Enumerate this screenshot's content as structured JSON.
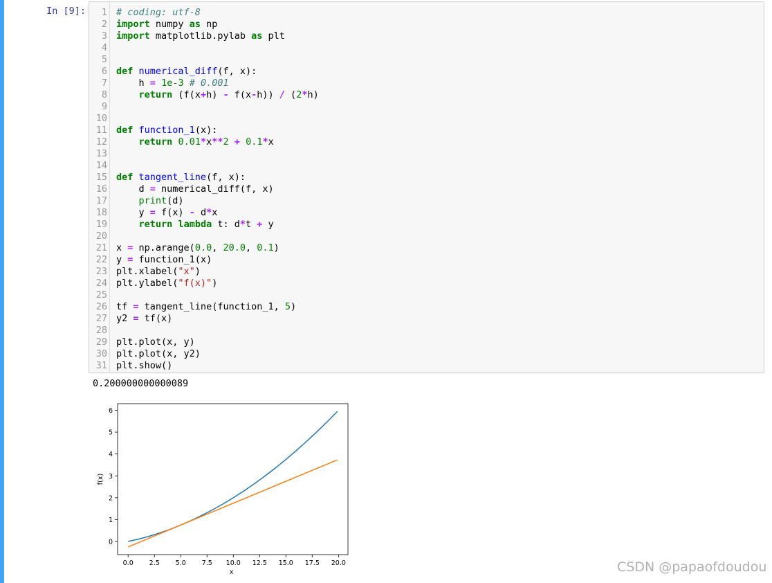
{
  "cell": {
    "prompt": "In [9]:",
    "lines": [
      [
        {
          "t": "# coding: utf-8",
          "c": "cm"
        }
      ],
      [
        {
          "t": "import",
          "c": "kw"
        },
        {
          "t": " numpy "
        },
        {
          "t": "as",
          "c": "kw"
        },
        {
          "t": " np"
        }
      ],
      [
        {
          "t": "import",
          "c": "kw"
        },
        {
          "t": " matplotlib.pylab "
        },
        {
          "t": "as",
          "c": "kw"
        },
        {
          "t": " plt"
        }
      ],
      [],
      [],
      [
        {
          "t": "def",
          "c": "kw"
        },
        {
          "t": " "
        },
        {
          "t": "numerical_diff",
          "c": "nf"
        },
        {
          "t": "(f, x):"
        }
      ],
      [
        {
          "t": "    h "
        },
        {
          "t": "=",
          "c": "op"
        },
        {
          "t": " "
        },
        {
          "t": "1e-3",
          "c": "num"
        },
        {
          "t": " "
        },
        {
          "t": "# 0.001",
          "c": "cm"
        }
      ],
      [
        {
          "t": "    "
        },
        {
          "t": "return",
          "c": "kw"
        },
        {
          "t": " (f(x"
        },
        {
          "t": "+",
          "c": "op"
        },
        {
          "t": "h) "
        },
        {
          "t": "-",
          "c": "op"
        },
        {
          "t": " f(x"
        },
        {
          "t": "-",
          "c": "op"
        },
        {
          "t": "h)) "
        },
        {
          "t": "/",
          "c": "op"
        },
        {
          "t": " ("
        },
        {
          "t": "2",
          "c": "num"
        },
        {
          "t": "*",
          "c": "op"
        },
        {
          "t": "h)"
        }
      ],
      [],
      [],
      [
        {
          "t": "def",
          "c": "kw"
        },
        {
          "t": " "
        },
        {
          "t": "function_1",
          "c": "nf"
        },
        {
          "t": "(x):"
        }
      ],
      [
        {
          "t": "    "
        },
        {
          "t": "return",
          "c": "kw"
        },
        {
          "t": " "
        },
        {
          "t": "0.01",
          "c": "num"
        },
        {
          "t": "*",
          "c": "op"
        },
        {
          "t": "x"
        },
        {
          "t": "**",
          "c": "op"
        },
        {
          "t": "2",
          "c": "num"
        },
        {
          "t": " "
        },
        {
          "t": "+",
          "c": "op"
        },
        {
          "t": " "
        },
        {
          "t": "0.1",
          "c": "num"
        },
        {
          "t": "*",
          "c": "op"
        },
        {
          "t": "x"
        }
      ],
      [],
      [],
      [
        {
          "t": "def",
          "c": "kw"
        },
        {
          "t": " "
        },
        {
          "t": "tangent_line",
          "c": "nf"
        },
        {
          "t": "(f, x):"
        }
      ],
      [
        {
          "t": "    d "
        },
        {
          "t": "=",
          "c": "op"
        },
        {
          "t": " numerical_diff(f, x)"
        }
      ],
      [
        {
          "t": "    "
        },
        {
          "t": "print",
          "c": "bi"
        },
        {
          "t": "(d)"
        }
      ],
      [
        {
          "t": "    y "
        },
        {
          "t": "=",
          "c": "op"
        },
        {
          "t": " f(x) "
        },
        {
          "t": "-",
          "c": "op"
        },
        {
          "t": " d"
        },
        {
          "t": "*",
          "c": "op"
        },
        {
          "t": "x"
        }
      ],
      [
        {
          "t": "    "
        },
        {
          "t": "return",
          "c": "kw"
        },
        {
          "t": " "
        },
        {
          "t": "lambda",
          "c": "kw"
        },
        {
          "t": " t: d"
        },
        {
          "t": "*",
          "c": "op"
        },
        {
          "t": "t "
        },
        {
          "t": "+",
          "c": "op"
        },
        {
          "t": " y"
        }
      ],
      [],
      [
        {
          "t": "x "
        },
        {
          "t": "=",
          "c": "op"
        },
        {
          "t": " np.arange("
        },
        {
          "t": "0.0",
          "c": "num"
        },
        {
          "t": ", "
        },
        {
          "t": "20.0",
          "c": "num"
        },
        {
          "t": ", "
        },
        {
          "t": "0.1",
          "c": "num"
        },
        {
          "t": ")"
        }
      ],
      [
        {
          "t": "y "
        },
        {
          "t": "=",
          "c": "op"
        },
        {
          "t": " function_1(x)"
        }
      ],
      [
        {
          "t": "plt.xlabel("
        },
        {
          "t": "\"x\"",
          "c": "str"
        },
        {
          "t": ")"
        }
      ],
      [
        {
          "t": "plt.ylabel("
        },
        {
          "t": "\"f(x)\"",
          "c": "str"
        },
        {
          "t": ")"
        }
      ],
      [],
      [
        {
          "t": "tf "
        },
        {
          "t": "=",
          "c": "op"
        },
        {
          "t": " tangent_line(function_1, "
        },
        {
          "t": "5",
          "c": "num"
        },
        {
          "t": ")"
        }
      ],
      [
        {
          "t": "y2 "
        },
        {
          "t": "=",
          "c": "op"
        },
        {
          "t": " tf(x)"
        }
      ],
      [],
      [
        {
          "t": "plt.plot(x, y)"
        }
      ],
      [
        {
          "t": "plt.plot(x, y2)"
        }
      ],
      [
        {
          "t": "plt.show()"
        }
      ]
    ]
  },
  "output": {
    "text": "0.200000000000089"
  },
  "chart_data": {
    "type": "line",
    "xlabel": "x",
    "ylabel": "f(x)",
    "xlim": [
      -1.0,
      20.9
    ],
    "ylim": [
      -0.6,
      6.3
    ],
    "xticks": [
      "0.0",
      "2.5",
      "5.0",
      "7.5",
      "10.0",
      "12.5",
      "15.0",
      "17.5",
      "20.0"
    ],
    "yticks": [
      "0",
      "1",
      "2",
      "3",
      "4",
      "5",
      "6"
    ],
    "grid": false,
    "series": [
      {
        "color": "#1f77b4",
        "x": [
          0,
          1,
          2,
          3,
          4,
          5,
          6,
          7,
          8,
          9,
          10,
          11,
          12,
          13,
          14,
          15,
          16,
          17,
          18,
          19,
          19.9
        ],
        "y": [
          0,
          0.11,
          0.24,
          0.39,
          0.56,
          0.75,
          0.96,
          1.19,
          1.44,
          1.71,
          2.0,
          2.31,
          2.64,
          2.99,
          3.36,
          3.75,
          4.16,
          4.59,
          5.04,
          5.51,
          5.95
        ]
      },
      {
        "color": "#ff7f0e",
        "x": [
          0,
          19.9
        ],
        "y": [
          -0.25,
          3.73
        ]
      }
    ]
  },
  "watermark": "CSDN @papaofdoudou"
}
